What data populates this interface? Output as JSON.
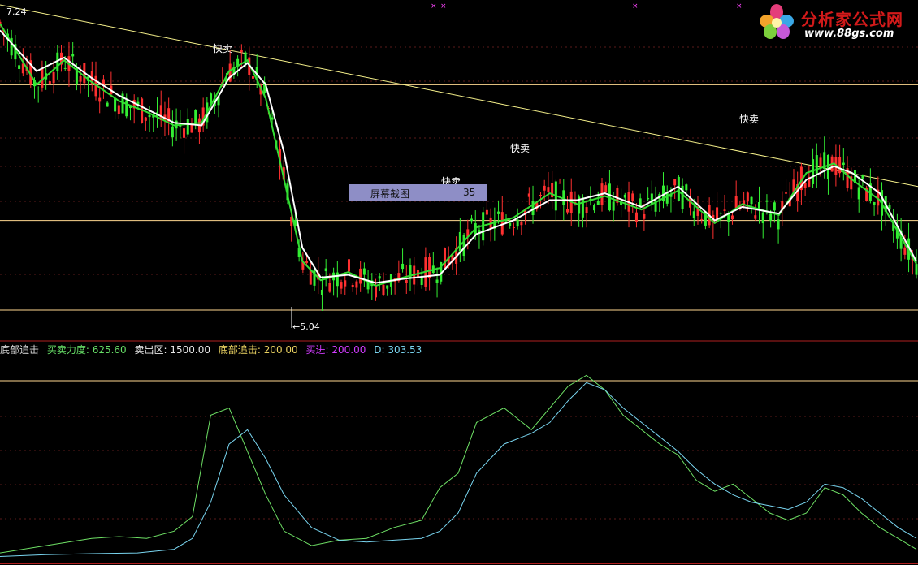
{
  "labels": {
    "top_left_price": "7.24",
    "low_price": "5.04",
    "sell_signal": "快卖",
    "tooltip_label": "屏幕截图",
    "tooltip_value": "35"
  },
  "legend": [
    {
      "text": "底部追击",
      "color": "#d8d8d8"
    },
    {
      "text": "买卖力度: 625.60",
      "color": "#66dd66"
    },
    {
      "text": "卖出区: 1500.00",
      "color": "#e8e8e8"
    },
    {
      "text": "底部追击: 200.00",
      "color": "#e8d060"
    },
    {
      "text": "买进: 200.00",
      "color": "#d23cff"
    },
    {
      "text": "D: 303.53",
      "color": "#79d5f0"
    }
  ],
  "logo": {
    "brand": "分析家公式网",
    "url": "www.88gs.com"
  },
  "colors": {
    "up_candle": "#ff3030",
    "down_candle": "#33ee33",
    "ma_white": "#ffffff",
    "ma_green": "#33dd33",
    "trend": "#f5f08a",
    "level": "#ffd890",
    "indicator_k": "#6ee065",
    "indicator_d": "#79d5f0",
    "buy_marker": "#ff44ff"
  },
  "chart_data": {
    "type": "candlestick",
    "price": {
      "high_label": 7.24,
      "low_label": 5.04,
      "ma_white": [
        [
          0,
          7.1
        ],
        [
          0.04,
          6.8
        ],
        [
          0.07,
          6.9
        ],
        [
          0.1,
          6.75
        ],
        [
          0.13,
          6.62
        ],
        [
          0.16,
          6.52
        ],
        [
          0.19,
          6.42
        ],
        [
          0.22,
          6.4
        ],
        [
          0.25,
          6.75
        ],
        [
          0.27,
          6.86
        ],
        [
          0.29,
          6.7
        ],
        [
          0.31,
          6.2
        ],
        [
          0.33,
          5.5
        ],
        [
          0.35,
          5.28
        ],
        [
          0.38,
          5.3
        ],
        [
          0.41,
          5.24
        ],
        [
          0.44,
          5.27
        ],
        [
          0.48,
          5.3
        ],
        [
          0.52,
          5.6
        ],
        [
          0.56,
          5.7
        ],
        [
          0.6,
          5.85
        ],
        [
          0.63,
          5.85
        ],
        [
          0.66,
          5.9
        ],
        [
          0.7,
          5.8
        ],
        [
          0.74,
          5.95
        ],
        [
          0.78,
          5.7
        ],
        [
          0.81,
          5.8
        ],
        [
          0.85,
          5.75
        ],
        [
          0.88,
          6.0
        ],
        [
          0.91,
          6.1
        ],
        [
          0.93,
          6.05
        ],
        [
          0.96,
          5.9
        ],
        [
          1.0,
          5.4
        ]
      ],
      "ma_green": [
        [
          0,
          7.15
        ],
        [
          0.04,
          6.7
        ],
        [
          0.07,
          6.88
        ],
        [
          0.1,
          6.72
        ],
        [
          0.13,
          6.58
        ],
        [
          0.16,
          6.5
        ],
        [
          0.19,
          6.4
        ],
        [
          0.22,
          6.42
        ],
        [
          0.25,
          6.8
        ],
        [
          0.27,
          6.88
        ],
        [
          0.29,
          6.6
        ],
        [
          0.31,
          6.0
        ],
        [
          0.33,
          5.4
        ],
        [
          0.35,
          5.26
        ],
        [
          0.38,
          5.32
        ],
        [
          0.41,
          5.22
        ],
        [
          0.44,
          5.28
        ],
        [
          0.48,
          5.35
        ],
        [
          0.52,
          5.65
        ],
        [
          0.56,
          5.72
        ],
        [
          0.6,
          5.9
        ],
        [
          0.63,
          5.82
        ],
        [
          0.66,
          5.88
        ],
        [
          0.7,
          5.78
        ],
        [
          0.74,
          5.92
        ],
        [
          0.78,
          5.68
        ],
        [
          0.81,
          5.82
        ],
        [
          0.85,
          5.74
        ],
        [
          0.88,
          6.05
        ],
        [
          0.91,
          6.12
        ],
        [
          0.93,
          6.0
        ],
        [
          0.96,
          5.85
        ],
        [
          1.0,
          5.38
        ]
      ],
      "level_lines": [
        6.7,
        5.7,
        5.04
      ],
      "signals": [
        "快卖",
        "快卖",
        "快卖",
        "快卖"
      ]
    },
    "indicator": {
      "series": [
        {
          "name": "买卖力度",
          "values": [
            [
              0,
              20
            ],
            [
              0.05,
              40
            ],
            [
              0.1,
              60
            ],
            [
              0.13,
              65
            ],
            [
              0.16,
              60
            ],
            [
              0.19,
              80
            ],
            [
              0.21,
              120
            ],
            [
              0.23,
              400
            ],
            [
              0.25,
              420
            ],
            [
              0.27,
              300
            ],
            [
              0.29,
              180
            ],
            [
              0.31,
              80
            ],
            [
              0.34,
              40
            ],
            [
              0.37,
              55
            ],
            [
              0.4,
              60
            ],
            [
              0.43,
              90
            ],
            [
              0.46,
              110
            ],
            [
              0.48,
              200
            ],
            [
              0.5,
              240
            ],
            [
              0.52,
              380
            ],
            [
              0.55,
              420
            ],
            [
              0.58,
              360
            ],
            [
              0.6,
              420
            ],
            [
              0.62,
              480
            ],
            [
              0.64,
              510
            ],
            [
              0.66,
              470
            ],
            [
              0.68,
              400
            ],
            [
              0.7,
              360
            ],
            [
              0.72,
              320
            ],
            [
              0.74,
              290
            ],
            [
              0.76,
              220
            ],
            [
              0.78,
              190
            ],
            [
              0.8,
              210
            ],
            [
              0.82,
              170
            ],
            [
              0.84,
              130
            ],
            [
              0.86,
              110
            ],
            [
              0.88,
              130
            ],
            [
              0.9,
              200
            ],
            [
              0.92,
              180
            ],
            [
              0.94,
              130
            ],
            [
              0.96,
              90
            ],
            [
              0.98,
              60
            ],
            [
              1.0,
              30
            ]
          ]
        },
        {
          "name": "D",
          "values": [
            [
              0,
              10
            ],
            [
              0.05,
              15
            ],
            [
              0.1,
              18
            ],
            [
              0.15,
              20
            ],
            [
              0.19,
              30
            ],
            [
              0.21,
              60
            ],
            [
              0.23,
              160
            ],
            [
              0.25,
              320
            ],
            [
              0.27,
              360
            ],
            [
              0.29,
              280
            ],
            [
              0.31,
              180
            ],
            [
              0.34,
              90
            ],
            [
              0.37,
              55
            ],
            [
              0.4,
              50
            ],
            [
              0.43,
              55
            ],
            [
              0.46,
              60
            ],
            [
              0.48,
              80
            ],
            [
              0.5,
              130
            ],
            [
              0.52,
              240
            ],
            [
              0.55,
              320
            ],
            [
              0.58,
              350
            ],
            [
              0.6,
              380
            ],
            [
              0.62,
              440
            ],
            [
              0.64,
              490
            ],
            [
              0.66,
              470
            ],
            [
              0.68,
              420
            ],
            [
              0.7,
              380
            ],
            [
              0.72,
              340
            ],
            [
              0.74,
              300
            ],
            [
              0.76,
              250
            ],
            [
              0.78,
              210
            ],
            [
              0.8,
              180
            ],
            [
              0.82,
              160
            ],
            [
              0.84,
              150
            ],
            [
              0.86,
              140
            ],
            [
              0.88,
              160
            ],
            [
              0.9,
              210
            ],
            [
              0.92,
              200
            ],
            [
              0.94,
              170
            ],
            [
              0.96,
              130
            ],
            [
              0.98,
              90
            ],
            [
              1.0,
              60
            ]
          ]
        }
      ],
      "sell_zone": 1500.0,
      "bottom_chase": 200.0,
      "buy": 200.0
    }
  }
}
